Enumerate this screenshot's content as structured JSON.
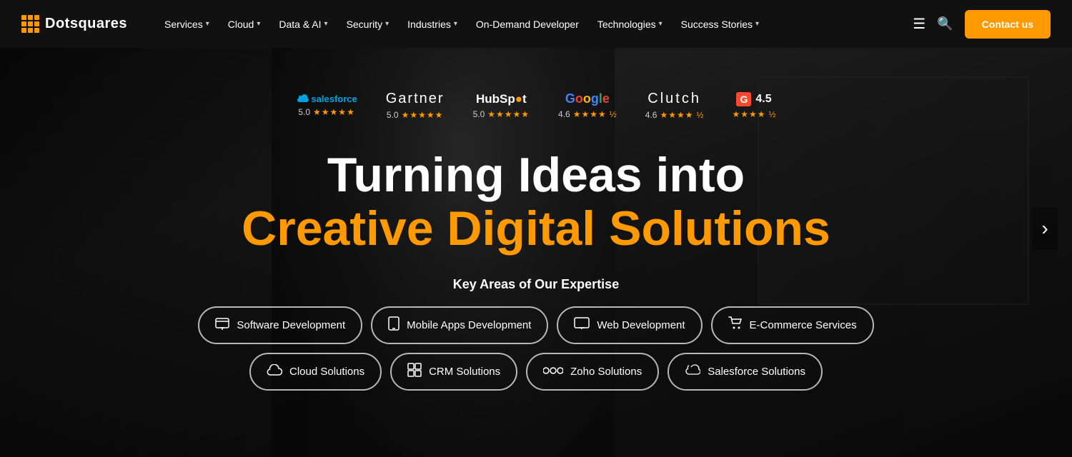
{
  "navbar": {
    "logo_text": "Dotsquares",
    "nav_items": [
      {
        "label": "Services",
        "has_dropdown": true
      },
      {
        "label": "Cloud",
        "has_dropdown": true
      },
      {
        "label": "Data & AI",
        "has_dropdown": true
      },
      {
        "label": "Security",
        "has_dropdown": true
      },
      {
        "label": "Industries",
        "has_dropdown": true
      },
      {
        "label": "On-Demand Developer",
        "has_dropdown": false
      },
      {
        "label": "Technologies",
        "has_dropdown": true
      },
      {
        "label": "Success Stories",
        "has_dropdown": true
      }
    ],
    "contact_label": "Contact us"
  },
  "ratings": [
    {
      "brand": "salesforce",
      "score": "5.0",
      "stars": 5
    },
    {
      "brand": "gartner",
      "score": "5.0",
      "stars": 5
    },
    {
      "brand": "hubspot",
      "score": "5.0",
      "stars": 5
    },
    {
      "brand": "google",
      "score": "4.6",
      "stars": 4.5
    },
    {
      "brand": "clutch",
      "score": "4.6",
      "stars": 4.5
    },
    {
      "brand": "g2",
      "score": "4.5",
      "stars": 4.5
    }
  ],
  "hero": {
    "heading_line1": "Turning Ideas into",
    "heading_line2": "Creative Digital Solutions",
    "key_areas_label": "Key Areas of Our Expertise"
  },
  "pills": [
    {
      "label": "Software Development",
      "icon": "💻",
      "row": 1
    },
    {
      "label": "Mobile Apps Development",
      "icon": "📱",
      "row": 1
    },
    {
      "label": "Web Development",
      "icon": "🖥",
      "row": 1
    },
    {
      "label": "E-Commerce Services",
      "icon": "🛒",
      "row": 1
    },
    {
      "label": "Cloud Solutions",
      "icon": "☁",
      "row": 2
    },
    {
      "label": "CRM Solutions",
      "icon": "⊞",
      "row": 2
    },
    {
      "label": "Zoho Solutions",
      "icon": "👁",
      "row": 2
    },
    {
      "label": "Salesforce Solutions",
      "icon": "☁",
      "row": 2
    }
  ]
}
